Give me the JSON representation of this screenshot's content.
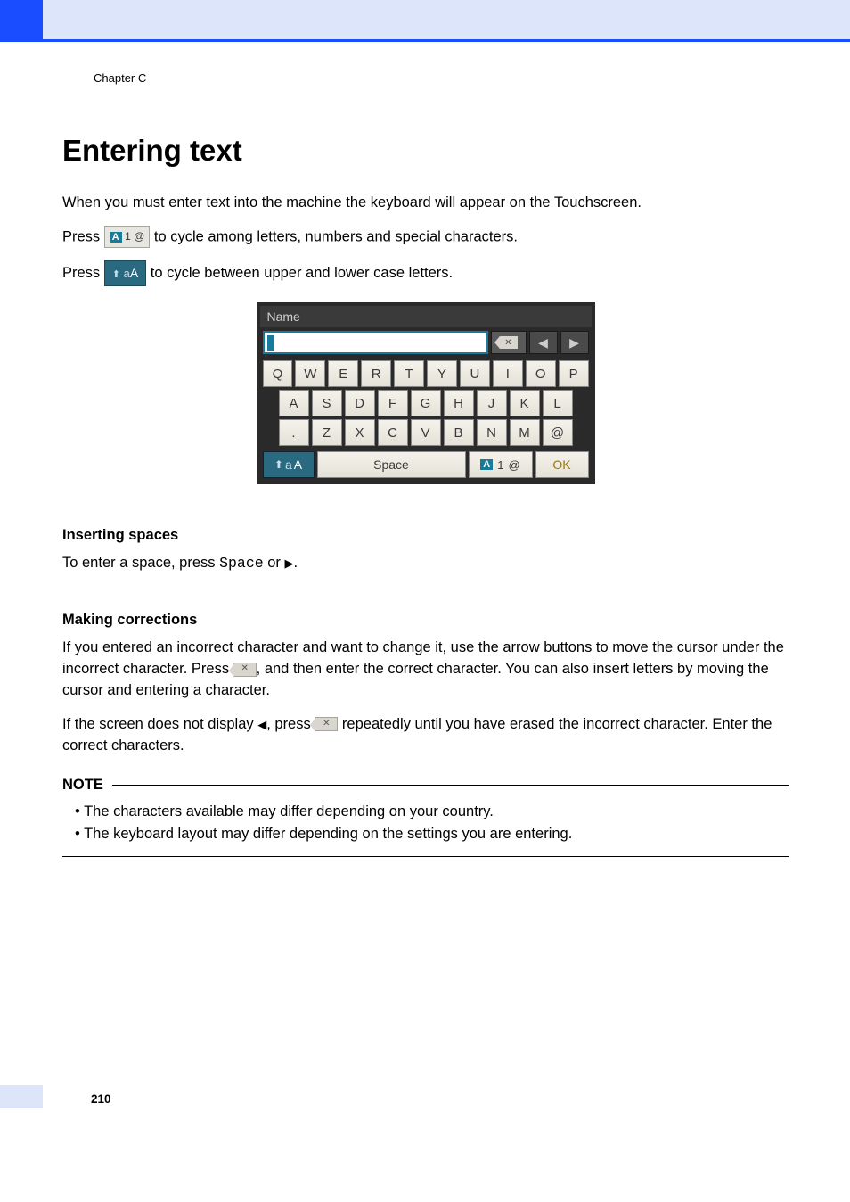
{
  "chapter_label": "Chapter C",
  "title": "Entering text",
  "intro": "When you must enter text into the machine the keyboard will appear on the Touchscreen.",
  "press1_a": "Press ",
  "press1_b": " to cycle among letters, numbers and special characters.",
  "press2_a": "Press ",
  "press2_b": " to cycle between upper and lower case letters.",
  "mode_chip": {
    "A": "A",
    "one": "1",
    "at": "@"
  },
  "shift_chip": {
    "a": "a",
    "A": "A"
  },
  "keyboard": {
    "title": "Name",
    "left_arrow": "◀",
    "right_arrow": "▶",
    "row1": [
      "Q",
      "W",
      "E",
      "R",
      "T",
      "Y",
      "U",
      "I",
      "O",
      "P"
    ],
    "row2": [
      "A",
      "S",
      "D",
      "F",
      "G",
      "H",
      "J",
      "K",
      "L"
    ],
    "row3": [
      ".",
      "Z",
      "X",
      "C",
      "V",
      "B",
      "N",
      "M",
      "@"
    ],
    "shift_a": "a",
    "shift_A": "A",
    "space": "Space",
    "mode_A": "A",
    "mode_1": "1",
    "mode_at": "@",
    "ok": "OK"
  },
  "sec1_h": "Inserting spaces",
  "sec1_a": "To enter a space, press ",
  "sec1_space": "Space",
  "sec1_b": " or ",
  "sec1_tri": "▶",
  "sec1_c": ".",
  "sec2_h": "Making corrections",
  "sec2_p1a": "If you entered an incorrect character and want to change it, use the arrow buttons to move the cursor under the incorrect character. Press ",
  "sec2_p1b": ", and then enter the correct character. You can also insert letters by moving the cursor and entering a character.",
  "sec2_p2a": "If the screen does not display ",
  "sec2_left": "◀",
  "sec2_p2b": ", press ",
  "sec2_p2c": " repeatedly until you have erased the incorrect character. Enter the correct characters.",
  "note_label": "NOTE",
  "notes": [
    "The characters available may differ depending on your country.",
    "The keyboard layout may differ depending on the settings you are entering."
  ],
  "page_number": "210"
}
